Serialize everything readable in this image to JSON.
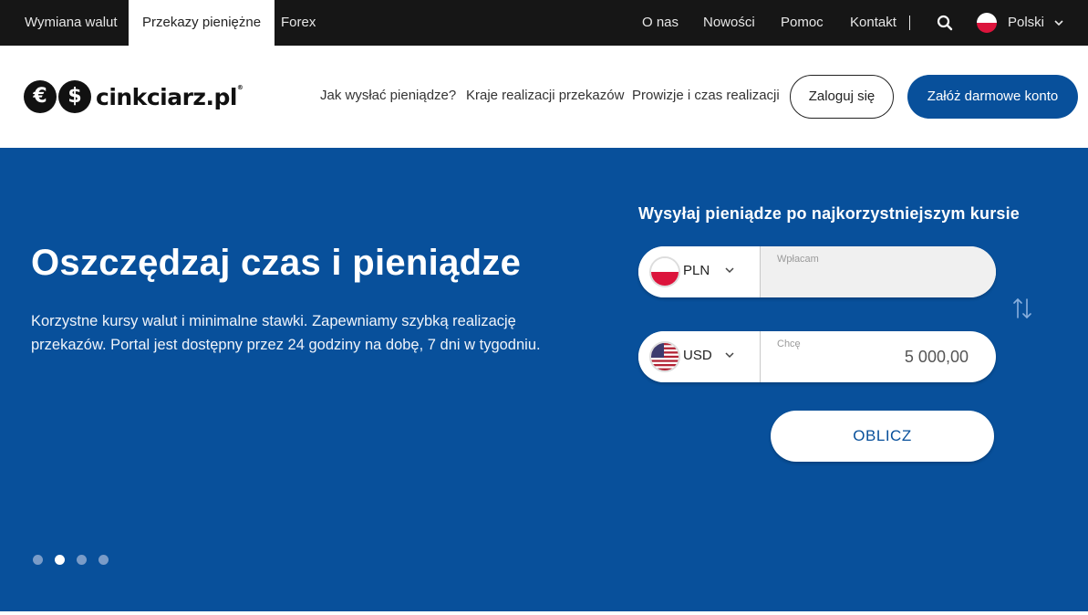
{
  "topbar": {
    "tabs": [
      "Wymiana walut",
      "Przekazy pieniężne",
      "Forex"
    ],
    "links": [
      "O nas",
      "Nowości",
      "Pomoc",
      "Kontakt"
    ],
    "language": "Polski"
  },
  "header": {
    "logo": "cinkciarz.pl",
    "logo_mark": "®",
    "nav": [
      "Jak wysłać pieniądze?",
      "Kraje realizacji przekazów",
      "Prowizje i czas realizacji"
    ],
    "login_label": "Zaloguj się",
    "signup_label": "Załóż darmowe konto"
  },
  "hero": {
    "title": "Oszczędzaj czas i pieniądze",
    "text": "Korzystne kursy walut i minimalne stawki. Zapewniamy szybką realizację przekazów. Portal jest dostępny przez 24 godziny na dobę, 7 dni w tygodniu.",
    "slides": {
      "count": 4,
      "active_index": 1
    }
  },
  "calculator": {
    "title": "Wysyłaj pieniądze po najkorzystniejszym kursie",
    "send": {
      "currency": "PLN",
      "label": "Wpłacam",
      "value": ""
    },
    "receive": {
      "currency": "USD",
      "label": "Chcę",
      "value": "5 000,00"
    },
    "button_label": "OBLICZ"
  },
  "colors": {
    "topbar_bg": "#161616",
    "brand_blue": "#08509b",
    "white": "#ffffff"
  }
}
